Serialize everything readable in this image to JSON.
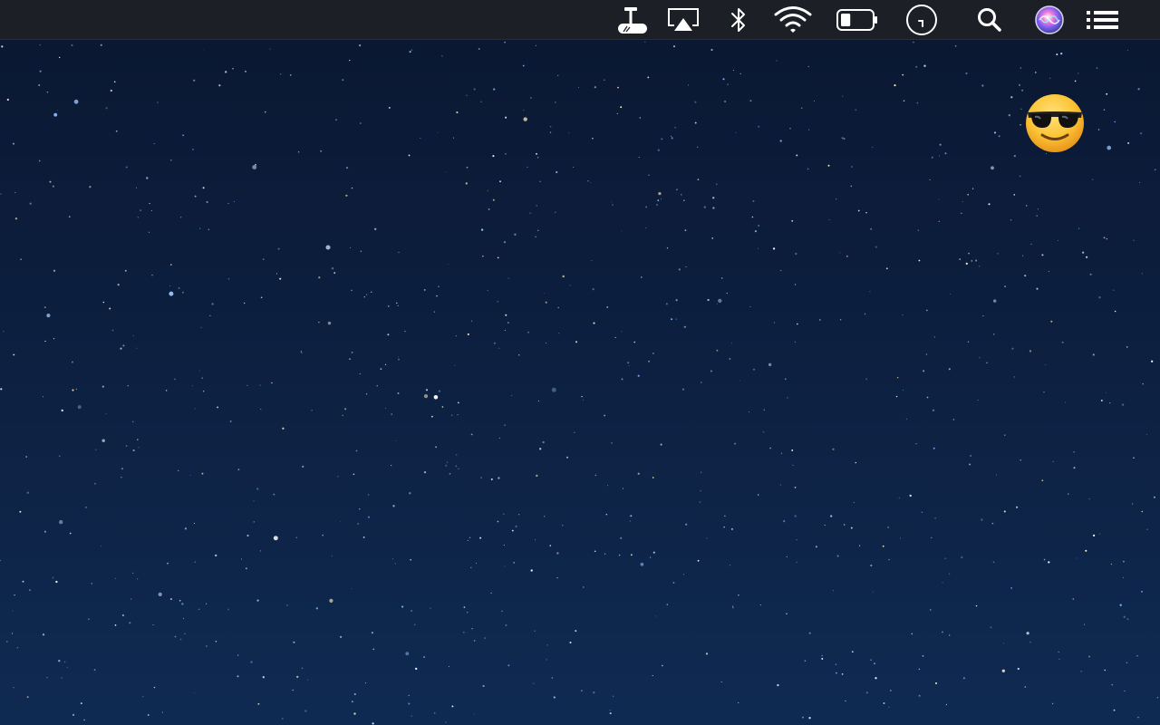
{
  "screen": {
    "wallpaper": "starry-night-sky",
    "colors": {
      "menubar_bg": "#1c1f26",
      "icon": "#ffffff",
      "wallpaper_top": "#0a1730",
      "wallpaper_bottom": "#0f2a52"
    }
  },
  "menubar": {
    "status_items": [
      {
        "id": "cleaning-utility",
        "icon": "brush-icon"
      },
      {
        "id": "airplay",
        "icon": "airplay-icon"
      },
      {
        "id": "bluetooth",
        "icon": "bluetooth-icon"
      },
      {
        "id": "wifi",
        "icon": "wifi-icon"
      },
      {
        "id": "battery",
        "icon": "battery-icon",
        "level": 0.3
      },
      {
        "id": "clock",
        "icon": "clock-icon"
      },
      {
        "id": "spotlight",
        "icon": "search-icon"
      },
      {
        "id": "siri",
        "icon": "siri-icon"
      },
      {
        "id": "notification-center",
        "icon": "list-icon"
      }
    ]
  },
  "desktop": {
    "floating_emoji": {
      "icon": "smiling-face-with-sunglasses-icon",
      "glyph": "😎"
    }
  }
}
